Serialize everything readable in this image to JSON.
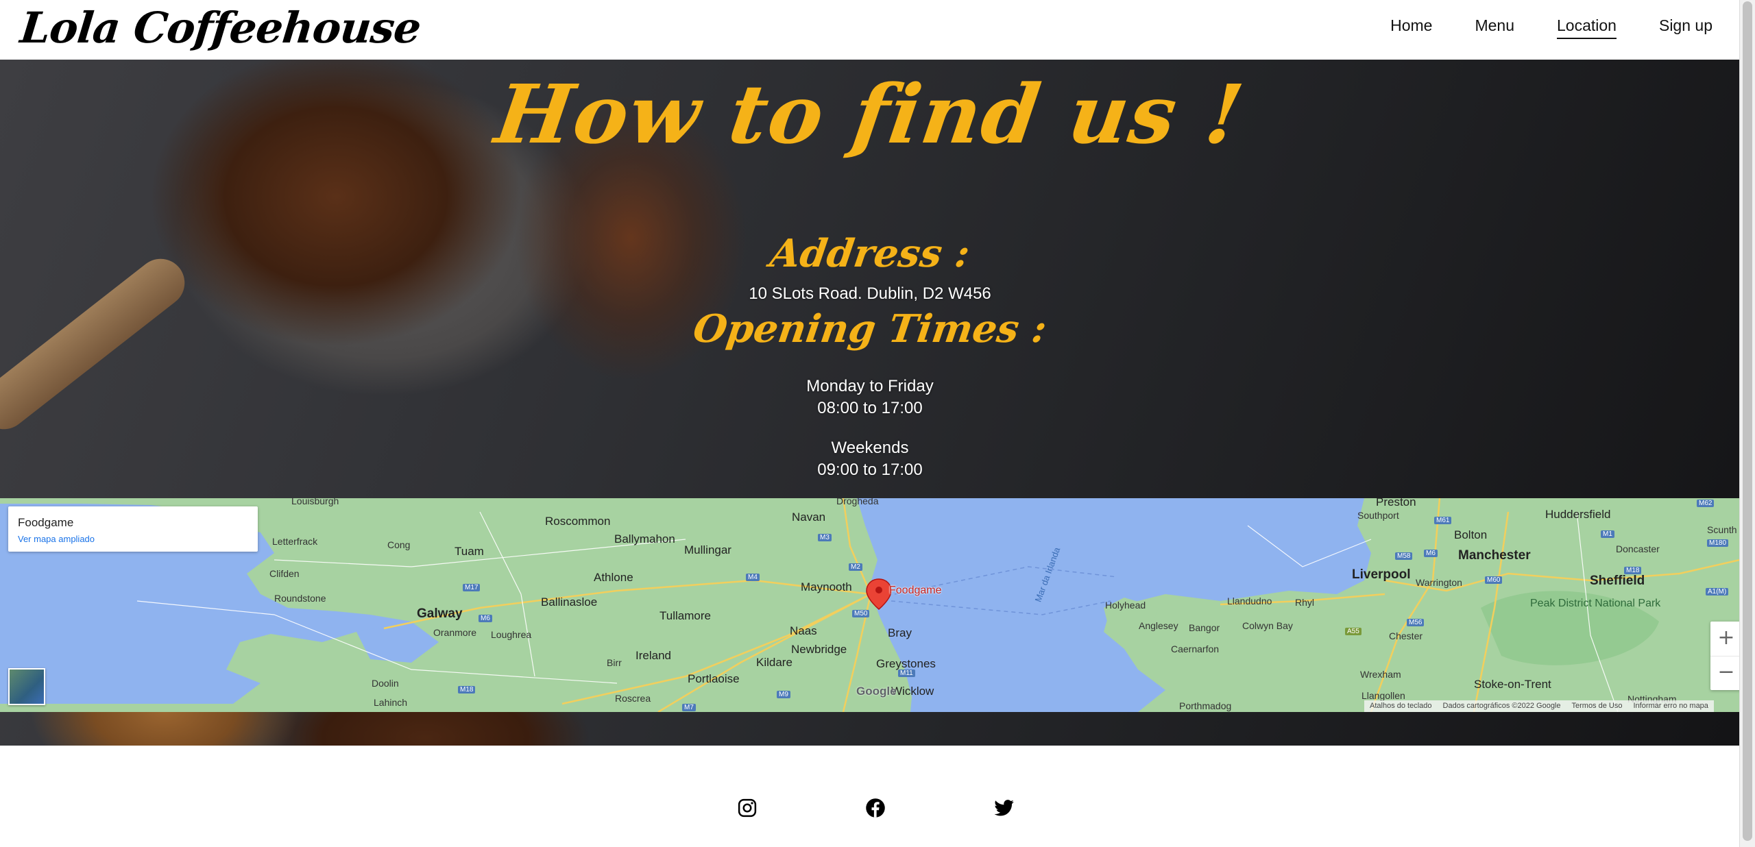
{
  "brand": "Lola Coffeehouse",
  "nav": {
    "home": "Home",
    "menu": "Menu",
    "location": "Location",
    "signup": "Sign up"
  },
  "hero": {
    "heading": "How to find us !",
    "address_heading": "Address :",
    "address": "10 SLots Road. Dublin, D2 W456",
    "opening_heading": "Opening Times :",
    "weekday_label": "Monday to Friday",
    "weekday_hours": "08:00 to 17:00",
    "weekend_label": "Weekends",
    "weekend_hours": "09:00 to 17:00",
    "heading_color": "#f5b218"
  },
  "map": {
    "place_name": "Foodgame",
    "larger_map_link": "Ver mapa ampliado",
    "pin_label": "Foodgame",
    "zoom_in": "+",
    "zoom_out": "−",
    "google_logo": "Google",
    "attribution": {
      "shortcuts": "Atalhos do teclado",
      "map_data": "Dados cartográficos ©2022 Google",
      "terms": "Termos de Uso",
      "report": "Informar erro no mapa"
    },
    "places": {
      "louisburgh": "Louisburgh",
      "roscommon": "Roscommon",
      "ballymahon": "Ballymahon",
      "navan": "Navan",
      "drogheda": "Drogheda",
      "letterfrack": "Letterfrack",
      "cong": "Cong",
      "tuam": "Tuam",
      "mullingar": "Mullingar",
      "athlone": "Athlone",
      "clifden": "Clifden",
      "roundstone": "Roundstone",
      "galway": "Galway",
      "oranmore": "Oranmore",
      "loughrea": "Loughrea",
      "ballinasloe": "Ballinasloe",
      "tullamore": "Tullamore",
      "maynooth": "Maynooth",
      "naas": "Naas",
      "bray": "Bray",
      "newbridge": "Newbridge",
      "kildare": "Kildare",
      "ireland": "Ireland",
      "birr": "Birr",
      "portlaoise": "Portlaoise",
      "greystones": "Greystones",
      "wicklow": "Wicklow",
      "doolin": "Doolin",
      "lahinch": "Lahinch",
      "roscrea": "Roscrea",
      "sea": "Mar da Irlanda",
      "preston": "Preston",
      "southport": "Southport",
      "bolton": "Bolton",
      "huddersfield": "Huddersfield",
      "manchester": "Manchester",
      "doncaster": "Doncaster",
      "liverpool": "Liverpool",
      "warrington": "Warrington",
      "sheffield": "Sheffield",
      "holyhead": "Holyhead",
      "llandudno": "Llandudno",
      "rhyl": "Rhyl",
      "anglesey": "Anglesey",
      "bangor": "Bangor",
      "colwyn_bay": "Colwyn Bay",
      "chester": "Chester",
      "caernarfon": "Caernarfon",
      "peak_district": "Peak District National Park",
      "wrexham": "Wrexham",
      "stoke": "Stoke-on-Trent",
      "llangollen": "Llangollen",
      "porthmadog": "Porthmadog",
      "nottingham": "Nottingham",
      "scunthorpe": "Scunth"
    },
    "roads": [
      "M61",
      "M62",
      "M1",
      "M180",
      "M58",
      "M6",
      "M60",
      "M18",
      "M56",
      "A1(M)",
      "A55",
      "M17",
      "M6",
      "M4",
      "M3",
      "M2",
      "M50",
      "M18",
      "M7",
      "M9",
      "M11"
    ]
  },
  "footer": {
    "instagram": "instagram-icon",
    "facebook": "facebook-icon",
    "twitter": "twitter-icon"
  }
}
